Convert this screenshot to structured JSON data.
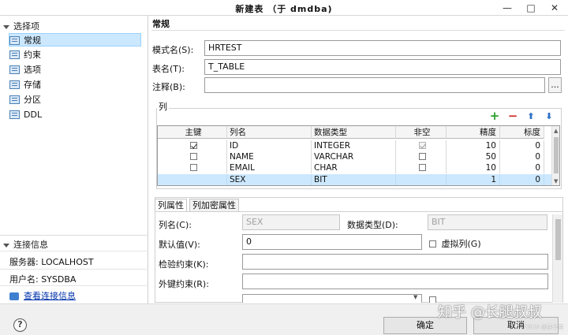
{
  "window": {
    "title": "新建表  （于 dmdba)",
    "minimize_glyph": "—",
    "maximize_glyph": "□",
    "close_glyph": "✕"
  },
  "left": {
    "options_header": "选择项",
    "nav": [
      {
        "label": "常规",
        "icon": "table-icon"
      },
      {
        "label": "约束",
        "icon": "table-icon"
      },
      {
        "label": "选项",
        "icon": "table-icon"
      },
      {
        "label": "存储",
        "icon": "table-icon"
      },
      {
        "label": "分区",
        "icon": "table-icon"
      },
      {
        "label": "DDL",
        "icon": "table-icon"
      }
    ],
    "connection_header": "连接信息",
    "server_label": "服务器: LOCALHOST",
    "user_label": "用户名: SYSDBA",
    "view_conn_link": "查看连接信息"
  },
  "general": {
    "section_title": "常规",
    "schema_label": "模式名(S):",
    "schema_value": "HRTEST",
    "table_label": "表名(T):",
    "table_value": "T_TABLE",
    "comment_label": "注释(B):",
    "comment_value": "",
    "comment_btn": "..."
  },
  "columns": {
    "group_title": "列",
    "toolbar": {
      "add": "+",
      "remove": "−",
      "up": "⬆",
      "down": "⬇"
    },
    "headers": [
      "主键",
      "列名",
      "数据类型",
      "非空",
      "精度",
      "标度"
    ],
    "rows": [
      {
        "pk": true,
        "name": "ID",
        "type": "INTEGER",
        "notnull": true,
        "notnull_disabled": true,
        "precision": "10",
        "scale": "0"
      },
      {
        "pk": false,
        "name": "NAME",
        "type": "VARCHAR",
        "notnull": false,
        "notnull_disabled": false,
        "precision": "50",
        "scale": "0"
      },
      {
        "pk": false,
        "name": "EMAIL",
        "type": "CHAR",
        "notnull": false,
        "notnull_disabled": false,
        "precision": "10",
        "scale": "0"
      },
      {
        "pk": false,
        "name": "SEX",
        "type": "BIT",
        "notnull": false,
        "notnull_disabled": false,
        "precision": "1",
        "scale": "0",
        "selected": true
      }
    ]
  },
  "props": {
    "tab_props": "列属性",
    "tab_encrypt": "列加密属性",
    "colname_label": "列名(C):",
    "colname_value": "SEX",
    "datatype_label": "数据类型(D):",
    "datatype_value": "BIT",
    "default_label": "默认值(V):",
    "default_value": "0",
    "virtual_label": "虚拟列(G)",
    "check_label": "检验约束(K):",
    "check_value": "",
    "fk_label": "外键约束(R):",
    "fk_value": ""
  },
  "footer": {
    "help": "?",
    "ok": "确定",
    "cancel": "取消",
    "watermark": "知乎 @长腿叔叔",
    "watermark_small": "CSDN @枯子若"
  },
  "colors": {
    "selection": "#cce8ff",
    "add_green": "#2e9e2e",
    "remove_red": "#d02a2a",
    "arrow_blue": "#2f6fc6"
  }
}
